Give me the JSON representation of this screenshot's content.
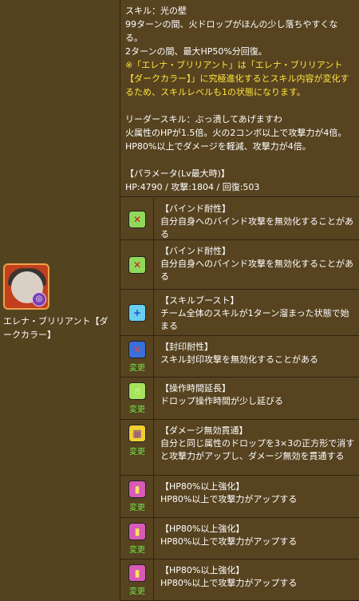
{
  "character": {
    "name": "エレナ・ブリリアント【ダークカラー】",
    "icon": "dark-color-elena-portrait"
  },
  "description": {
    "lines": [
      {
        "text": "スキル：光の壁",
        "color": "white"
      },
      {
        "text": "99ターンの間、火ドロップがほんの少し落ちやすくなる。",
        "color": "white"
      },
      {
        "text": "2ターンの間、最大HP50%分回復。",
        "color": "white"
      },
      {
        "text": "※「エレナ・ブリリアント」は「エレナ・ブリリアント【ダークカラー】」に究極進化するとスキル内容が変化するため、スキルレベルも1の状態になります。",
        "color": "yellow"
      },
      {
        "text": "",
        "color": "white"
      },
      {
        "text": "リーダースキル：ぶっ潰してあげますわ",
        "color": "white"
      },
      {
        "text": "火属性のHPが1.5倍。火の2コンボ以上で攻撃力が4倍。",
        "color": "white"
      },
      {
        "text": "HP80%以上でダメージを軽減、攻撃力が4倍。",
        "color": "white"
      },
      {
        "text": "",
        "color": "white"
      },
      {
        "text": "【パラメータ(Lv最大時)】",
        "color": "white"
      },
      {
        "text": "HP:4790 / 攻撃:1804 / 回復:503",
        "color": "white"
      }
    ]
  },
  "awakenings": [
    {
      "icon": "bind-resist-icon",
      "change": "",
      "title": "【バインド耐性】",
      "body": "自分自身へのバインド攻撃を無効化することがある"
    },
    {
      "icon": "bind-resist-icon",
      "change": "",
      "title": "【バインド耐性】",
      "body": "自分自身へのバインド攻撃を無効化することがある"
    },
    {
      "icon": "skill-boost-icon",
      "change": "",
      "title": "【スキルブースト】",
      "body": "チーム全体のスキルが1ターン溜まった状態で始まる"
    },
    {
      "icon": "seal-resist-icon",
      "change": "変更",
      "title": "【封印耐性】",
      "body": "スキル封印攻撃を無効化することがある"
    },
    {
      "icon": "time-extend-icon",
      "change": "変更",
      "title": "【操作時間延長】",
      "body": "ドロップ操作時間が少し延びる"
    },
    {
      "icon": "damage-void-pierce-icon",
      "change": "変更",
      "title": "【ダメージ無効貫通】",
      "body": "自分と同じ属性のドロップを3×3の正方形で消すと攻撃力がアップし、ダメージ無効を貫通する"
    },
    {
      "icon": "hp80-boost-icon",
      "change": "変更",
      "title": "【HP80%以上強化】",
      "body": "HP80%以上で攻撃力がアップする"
    },
    {
      "icon": "hp80-boost-icon",
      "change": "変更",
      "title": "【HP80%以上強化】",
      "body": "HP80%以上で攻撃力がアップする"
    },
    {
      "icon": "hp80-boost-icon",
      "change": "変更",
      "title": "【HP80%以上強化】",
      "body": "HP80%以上で攻撃力がアップする"
    }
  ]
}
